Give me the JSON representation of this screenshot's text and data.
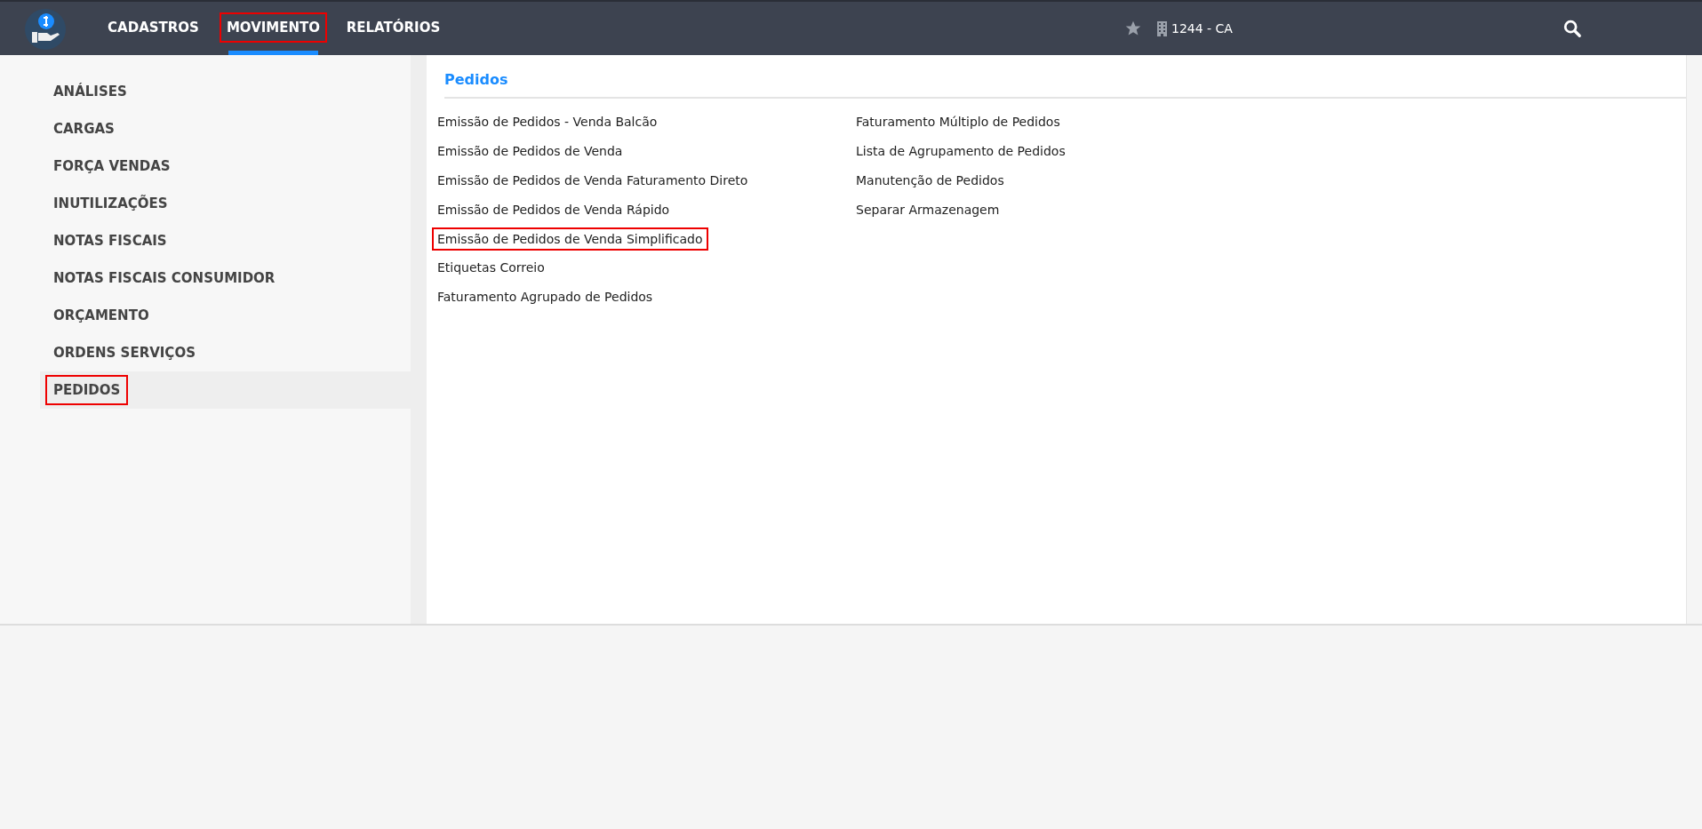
{
  "nav": {
    "items": [
      {
        "label": "CADASTROS",
        "selected": false,
        "highlighted": false
      },
      {
        "label": "MOVIMENTO",
        "selected": true,
        "highlighted": true
      },
      {
        "label": "RELATÓRIOS",
        "selected": false,
        "highlighted": false
      }
    ],
    "company": "1244 - CA"
  },
  "sidebar": {
    "items": [
      {
        "label": "ANÁLISES",
        "selected": false,
        "highlighted": false
      },
      {
        "label": "CARGAS",
        "selected": false,
        "highlighted": false
      },
      {
        "label": "FORÇA VENDAS",
        "selected": false,
        "highlighted": false
      },
      {
        "label": "INUTILIZAÇÕES",
        "selected": false,
        "highlighted": false
      },
      {
        "label": "NOTAS FISCAIS",
        "selected": false,
        "highlighted": false
      },
      {
        "label": "NOTAS FISCAIS CONSUMIDOR",
        "selected": false,
        "highlighted": false
      },
      {
        "label": "ORÇAMENTO",
        "selected": false,
        "highlighted": false
      },
      {
        "label": "ORDENS SERVIÇOS",
        "selected": false,
        "highlighted": false
      },
      {
        "label": "PEDIDOS",
        "selected": true,
        "highlighted": true
      }
    ]
  },
  "content": {
    "title": "Pedidos",
    "columns": [
      [
        {
          "label": "Emissão de Pedidos - Venda Balcão",
          "highlighted": false
        },
        {
          "label": "Emissão de Pedidos de Venda",
          "highlighted": false
        },
        {
          "label": "Emissão de Pedidos de Venda Faturamento Direto",
          "highlighted": false
        },
        {
          "label": "Emissão de Pedidos de Venda Rápido",
          "highlighted": false
        },
        {
          "label": "Emissão de Pedidos de Venda Simplificado",
          "highlighted": true
        },
        {
          "label": "Etiquetas Correio",
          "highlighted": false
        },
        {
          "label": "Faturamento Agrupado de Pedidos",
          "highlighted": false
        }
      ],
      [
        {
          "label": "Faturamento Múltiplo de Pedidos",
          "highlighted": false
        },
        {
          "label": "Lista de Agrupamento de Pedidos",
          "highlighted": false
        },
        {
          "label": "Manutenção de Pedidos",
          "highlighted": false
        },
        {
          "label": "Separar Armazenagem",
          "highlighted": false
        }
      ]
    ]
  }
}
